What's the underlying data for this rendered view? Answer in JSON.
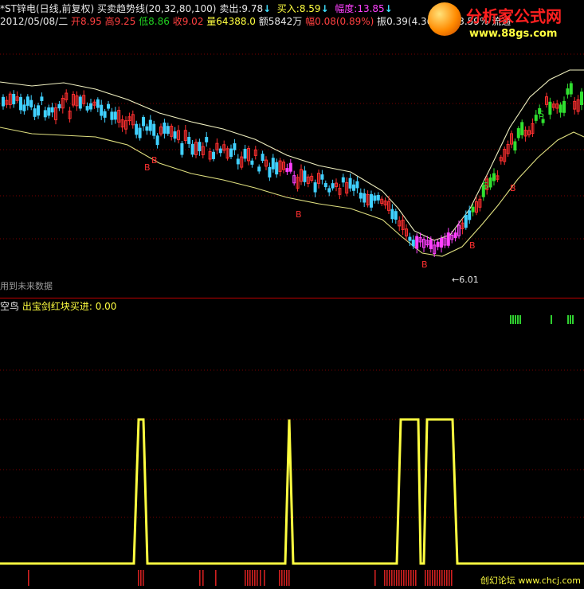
{
  "header": {
    "title": "*ST锌电(日线,前复权)",
    "indicator": "买卖趋势线(20,32,80,100)",
    "sell_label": "卖出:",
    "sell_value": "9.78",
    "buy_label": "买入:",
    "buy_value": "8.59",
    "range_label": "幅度:",
    "range_value": "13.85",
    "arrow": "↓",
    "date": "2012/05/08/二",
    "open": "开8.95",
    "high": "高9.25",
    "low": "低8.86",
    "close": "收9.02",
    "volume": "量64388.0",
    "amount": "额5842万",
    "change": "幅0.08(0.89%)",
    "amplitude": "振0.39(4.36%)",
    "turnover": "换3.59%",
    "extra": "流通"
  },
  "main_chart": {
    "future_label": "用到未来数据",
    "low_marker": "←6.01",
    "signal_buy": "B",
    "signal_sell": "S"
  },
  "indicator_panel": {
    "title_a": "空鸟",
    "title_b": "出宝剑红块买进:",
    "title_value": "0.00"
  },
  "watermark": {
    "logo_text": "分析家公式网",
    "logo_url": "www.88gs.com",
    "footer_text": "创幻论坛 www.chcj.com"
  },
  "colors": {
    "background": "#000000",
    "up": "#ff3030",
    "down": "#40d0ff",
    "signal_line": "#ffff40",
    "band": "#f0f0c0",
    "separator": "#c00000"
  },
  "chart_data": {
    "type": "line",
    "title": "买卖趋势线(20,32,80,100)",
    "series": [
      {
        "name": "卖出",
        "values": [
          9.78
        ]
      },
      {
        "name": "买入",
        "values": [
          8.59
        ]
      },
      {
        "name": "幅度",
        "values": [
          13.85
        ]
      }
    ],
    "low_price": 6.01,
    "signal_value": 0.0
  }
}
